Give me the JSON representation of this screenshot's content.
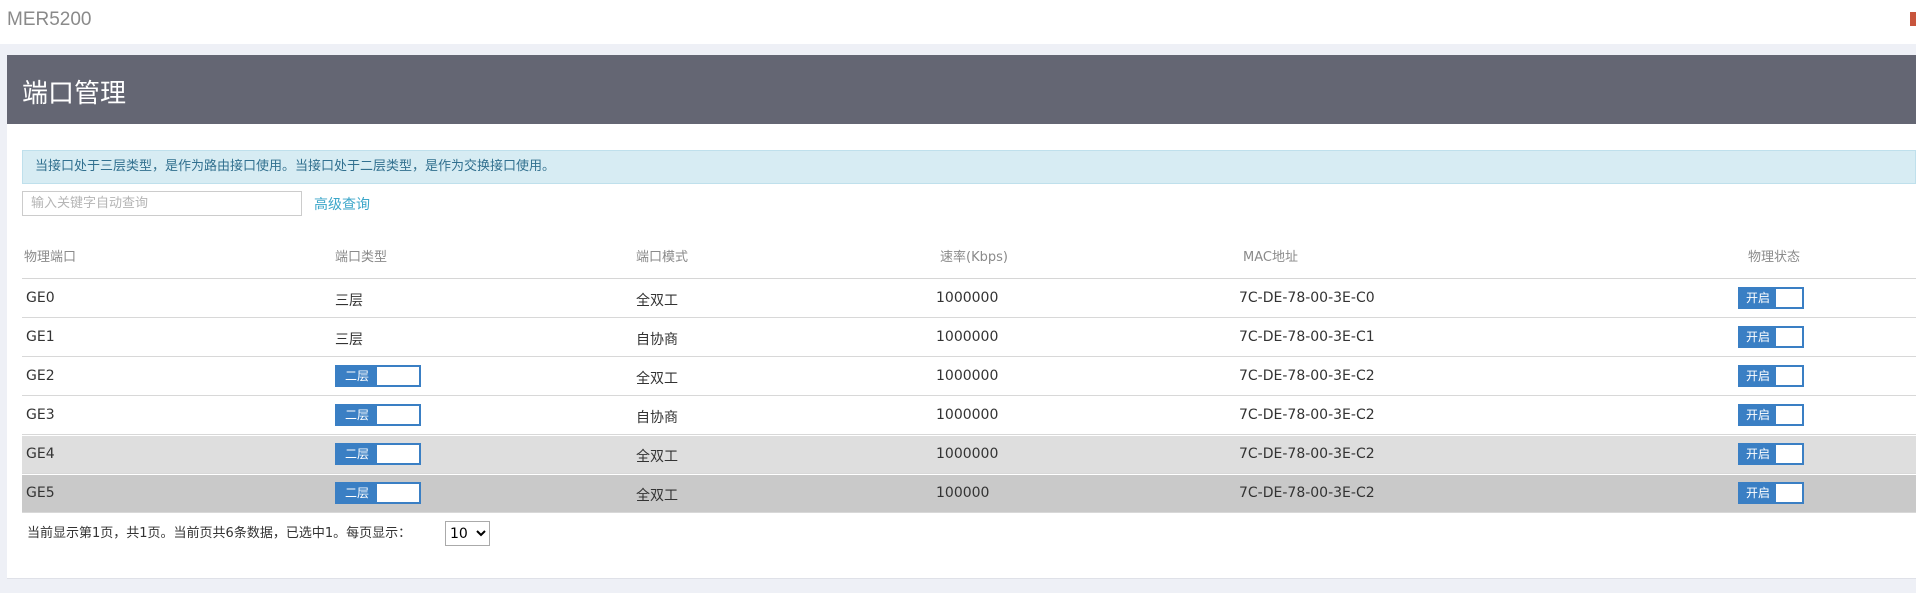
{
  "app": {
    "title": "MER5200"
  },
  "header": {
    "title": "端口管理"
  },
  "notice": {
    "text": "当接口处于三层类型，是作为路由接口使用。当接口处于二层类型，是作为交换接口使用。"
  },
  "search": {
    "placeholder": "输入关键字自动查询",
    "value": "",
    "advanced_label": "高级查询"
  },
  "table": {
    "columns": [
      "物理端口",
      "端口类型",
      "端口模式",
      "速率(Kbps)",
      "MAC地址",
      "物理状态"
    ],
    "rows": [
      {
        "port": "GE0",
        "type": "三层",
        "type_toggle": false,
        "mode": "全双工",
        "speed": "1000000",
        "mac": "7C-DE-78-00-3E-C0",
        "state": "开启",
        "highlight": "none"
      },
      {
        "port": "GE1",
        "type": "三层",
        "type_toggle": false,
        "mode": "自协商",
        "speed": "1000000",
        "mac": "7C-DE-78-00-3E-C1",
        "state": "开启",
        "highlight": "none"
      },
      {
        "port": "GE2",
        "type": "二层",
        "type_toggle": true,
        "mode": "全双工",
        "speed": "1000000",
        "mac": "7C-DE-78-00-3E-C2",
        "state": "开启",
        "highlight": "none"
      },
      {
        "port": "GE3",
        "type": "二层",
        "type_toggle": true,
        "mode": "自协商",
        "speed": "1000000",
        "mac": "7C-DE-78-00-3E-C2",
        "state": "开启",
        "highlight": "none"
      },
      {
        "port": "GE4",
        "type": "二层",
        "type_toggle": true,
        "mode": "全双工",
        "speed": "1000000",
        "mac": "7C-DE-78-00-3E-C2",
        "state": "开启",
        "highlight": "hover"
      },
      {
        "port": "GE5",
        "type": "二层",
        "type_toggle": true,
        "mode": "全双工",
        "speed": "100000",
        "mac": "7C-DE-78-00-3E-C2",
        "state": "开启",
        "highlight": "selected"
      }
    ]
  },
  "footer": {
    "status": "当前显示第1页，共1页。当前页共6条数据，已选中1。每页显示：",
    "page_size": "10"
  },
  "colors": {
    "header_bg": "#646673",
    "toggle_blue": "#3a7fc4",
    "notice_bg": "#d7ecf3",
    "link": "#3ba6c9"
  }
}
